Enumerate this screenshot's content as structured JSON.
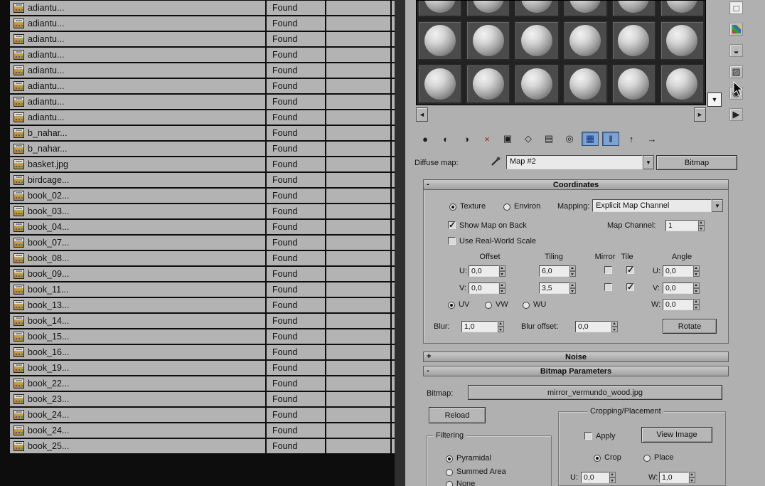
{
  "file_table": {
    "rows": [
      {
        "name": "adiantu...",
        "status": "Found"
      },
      {
        "name": "adiantu...",
        "status": "Found"
      },
      {
        "name": "adiantu...",
        "status": "Found"
      },
      {
        "name": "adiantu...",
        "status": "Found"
      },
      {
        "name": "adiantu...",
        "status": "Found"
      },
      {
        "name": "adiantu...",
        "status": "Found"
      },
      {
        "name": "adiantu...",
        "status": "Found"
      },
      {
        "name": "adiantu...",
        "status": "Found"
      },
      {
        "name": "b_nahar...",
        "status": "Found"
      },
      {
        "name": "b_nahar...",
        "status": "Found"
      },
      {
        "name": "basket.jpg",
        "status": "Found"
      },
      {
        "name": "birdcage...",
        "status": "Found"
      },
      {
        "name": "book_02...",
        "status": "Found"
      },
      {
        "name": "book_03...",
        "status": "Found"
      },
      {
        "name": "book_04...",
        "status": "Found"
      },
      {
        "name": "book_07...",
        "status": "Found"
      },
      {
        "name": "book_08...",
        "status": "Found"
      },
      {
        "name": "book_09...",
        "status": "Found"
      },
      {
        "name": "book_11...",
        "status": "Found"
      },
      {
        "name": "book_13...",
        "status": "Found"
      },
      {
        "name": "book_14...",
        "status": "Found"
      },
      {
        "name": "book_15...",
        "status": "Found"
      },
      {
        "name": "book_16...",
        "status": "Found"
      },
      {
        "name": "book_19...",
        "status": "Found"
      },
      {
        "name": "book_22...",
        "status": "Found"
      },
      {
        "name": "book_23...",
        "status": "Found"
      },
      {
        "name": "book_24...",
        "status": "Found"
      },
      {
        "name": "book_24...",
        "status": "Found"
      },
      {
        "name": "book_25...",
        "status": "Found"
      }
    ]
  },
  "material_editor": {
    "sample_slots": {
      "count": 18
    },
    "slot_nav": {
      "left_arrow": "◄",
      "right_arrow": "►",
      "dropdown_arrow": "▼"
    },
    "side_toolbar": [
      {
        "name": "sample-type-icon",
        "glyph": "□"
      },
      {
        "name": "background-icon",
        "glyph": ""
      },
      {
        "name": "backlight-icon",
        "glyph": "◒"
      },
      {
        "name": "sample-uv-tiling-icon",
        "glyph": "▨"
      },
      {
        "name": "video-color-check-icon",
        "glyph": "◉"
      },
      {
        "name": "make-preview-icon",
        "glyph": "▶"
      }
    ],
    "toolbar": [
      {
        "name": "get-material-icon",
        "glyph": "●"
      },
      {
        "name": "put-material-to-scene-icon",
        "glyph": "◐"
      },
      {
        "name": "assign-material-to-selection-icon",
        "glyph": "◑"
      },
      {
        "name": "reset-map-icon",
        "glyph": "×",
        "color": "#a81f1f"
      },
      {
        "name": "make-material-copy-icon",
        "glyph": "▣"
      },
      {
        "name": "make-unique-icon",
        "glyph": "◇"
      },
      {
        "name": "put-to-library-icon",
        "glyph": "▤"
      },
      {
        "name": "material-id-channel-icon",
        "glyph": "◎"
      },
      {
        "name": "show-map-in-viewport-icon",
        "glyph": "▦",
        "pressed": true,
        "color": "#13317a"
      },
      {
        "name": "show-end-result-icon",
        "glyph": "‖",
        "pressed": true
      },
      {
        "name": "go-to-parent-icon",
        "glyph": "↑"
      },
      {
        "name": "go-forward-to-sibling-icon",
        "glyph": "→"
      }
    ],
    "map_bar": {
      "label": "Diffuse map:",
      "map_value": "Map #2",
      "type_button": "Bitmap"
    },
    "coordinates": {
      "minimize_glyph": "-",
      "title": "Coordinates",
      "texture_label": "Texture",
      "environ_label": "Environ",
      "mapping_label": "Mapping:",
      "mapping_value": "Explicit Map Channel",
      "show_map_on_back_label": "Show Map on Back",
      "map_channel_label": "Map Channel:",
      "map_channel_value": "1",
      "use_real_world_scale_label": "Use Real-World Scale",
      "offset_header": "Offset",
      "tiling_header": "Tiling",
      "mirror_header": "Mirror",
      "tile_header": "Tile",
      "angle_header": "Angle",
      "u_label": "U:",
      "v_label": "V:",
      "w_label": "W:",
      "u_offset": "0,0",
      "u_tiling": "6,0",
      "v_offset": "0,0",
      "v_tiling": "3,5",
      "u_angle": "0,0",
      "v_angle": "0,0",
      "w_angle": "0,0",
      "uv_label": "UV",
      "vw_label": "VW",
      "wu_label": "WU",
      "blur_label": "Blur:",
      "blur_value": "1,0",
      "blur_offset_label": "Blur offset:",
      "blur_offset_value": "0,0",
      "rotate_button": "Rotate"
    },
    "noise": {
      "expand_glyph": "+",
      "title": "Noise"
    },
    "bitmap_params": {
      "minimize_glyph": "-",
      "title": "Bitmap Parameters",
      "bitmap_label": "Bitmap:",
      "bitmap_path": "mirror_vermundo_wood.jpg",
      "reload_button": "Reload",
      "cropping": {
        "title": "Cropping/Placement",
        "apply_label": "Apply",
        "view_image_button": "View Image",
        "crop_label": "Crop",
        "place_label": "Place",
        "u_label": "U:",
        "u_value": "0,0",
        "w_label": "W:",
        "w_value": "1,0"
      },
      "filtering": {
        "title": "Filtering",
        "pyramidal_label": "Pyramidal",
        "summed_area_label": "Summed Area",
        "none_label": "None"
      }
    }
  }
}
